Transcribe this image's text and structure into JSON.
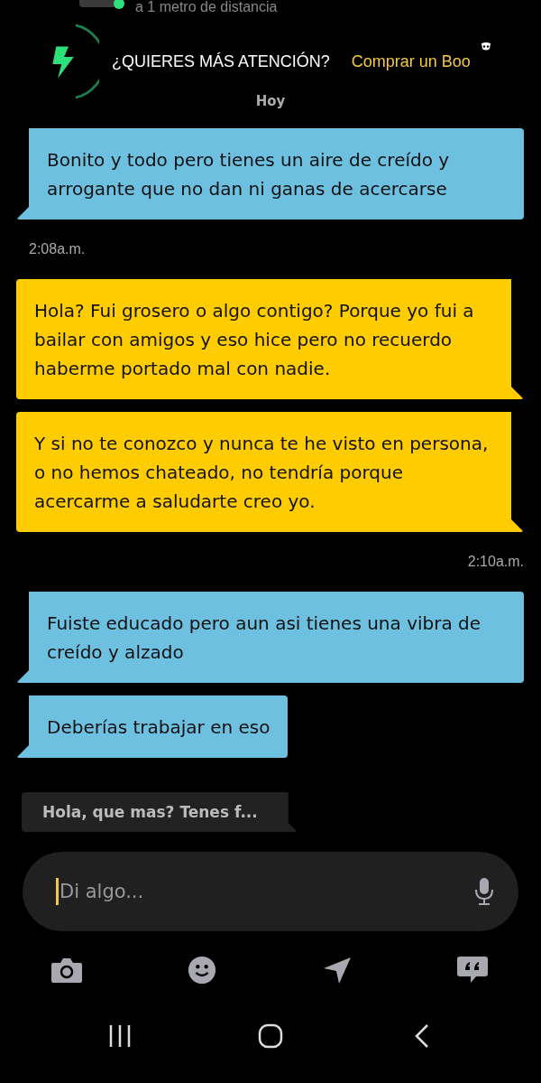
{
  "profile": {
    "distance": "a 1 metro de distancia",
    "online": true
  },
  "promo": {
    "title": "¿QUIERES MÁS ATENCIÓN?",
    "action": "Comprar un Boo"
  },
  "day_label": "Hoy",
  "messages": [
    {
      "kind": "bubble",
      "outgoing": false,
      "text": "Bonito y todo pero tienes un aire de creído y arrogante que no dan ni ganas de acercarse"
    },
    {
      "kind": "timestamp",
      "outgoing": false,
      "text": "2:08a.m."
    },
    {
      "kind": "bubble",
      "outgoing": true,
      "text": "Hola? Fui grosero o algo contigo? Porque yo fui a bailar con amigos y eso hice pero no recuerdo haberme portado mal con nadie."
    },
    {
      "kind": "bubble",
      "outgoing": true,
      "text": "Y si no te conozco y nunca te he visto en persona, o no hemos chateado, no tendría porque acercarme a saludarte creo yo."
    },
    {
      "kind": "timestamp",
      "outgoing": true,
      "text": "2:10a.m."
    },
    {
      "kind": "bubble",
      "outgoing": false,
      "text": "Fuiste educado pero aun asi tienes una vibra de creído y alzado"
    },
    {
      "kind": "bubble",
      "outgoing": false,
      "text": "Deberías trabajar en eso"
    }
  ],
  "suggestion": "Hola, que mas? Tenes f...",
  "composer": {
    "placeholder": "Di algo..."
  }
}
